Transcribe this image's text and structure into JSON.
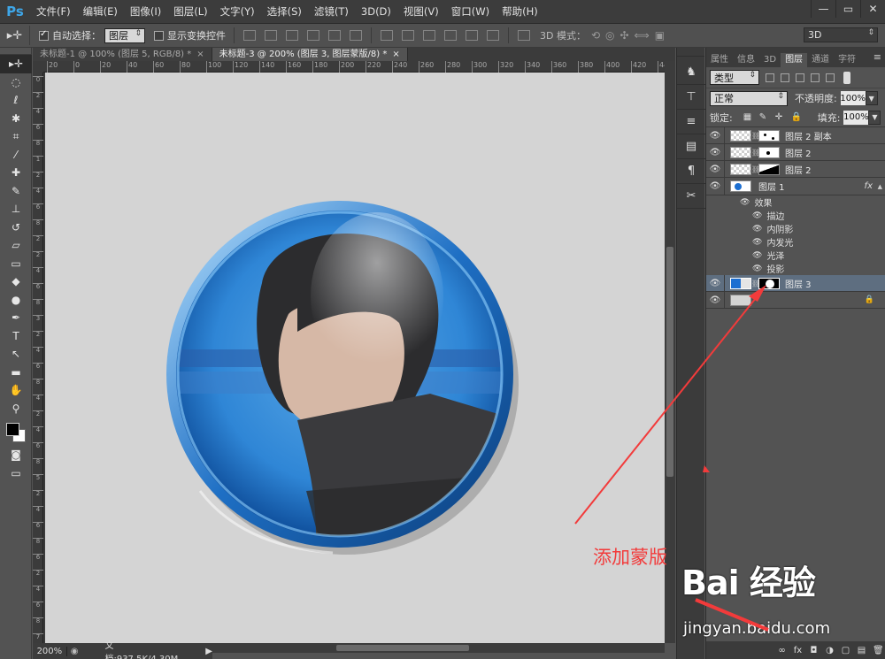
{
  "app": {
    "logo": "Ps"
  },
  "menu": [
    "文件(F)",
    "编辑(E)",
    "图像(I)",
    "图层(L)",
    "文字(Y)",
    "选择(S)",
    "滤镜(T)",
    "3D(D)",
    "视图(V)",
    "窗口(W)",
    "帮助(H)"
  ],
  "window_controls": {
    "minimize": "—",
    "maximize": "▭",
    "close": "✕"
  },
  "options": {
    "auto_select_label": "自动选择：",
    "auto_select_value": "图层",
    "show_transform_label": "显示变换控件",
    "mode_3d_label": "3D 模式：",
    "workspace": "3D"
  },
  "doc_tabs": [
    {
      "label": "未标题-1 @ 100% (图层 5, RGB/8) *",
      "close": "×"
    },
    {
      "label": "未标题-3 @ 200% (图层 3, 图层蒙版/8) *",
      "close": "×"
    }
  ],
  "ruler_top_ticks": [
    "20",
    "0",
    "20",
    "40",
    "60",
    "80",
    "100",
    "120",
    "140",
    "160",
    "180",
    "200",
    "220",
    "240",
    "260",
    "280",
    "300",
    "320",
    "340",
    "360",
    "380",
    "400",
    "420",
    "440"
  ],
  "ruler_left_ticks": [
    "0",
    "2",
    "4",
    "6",
    "8",
    "1",
    "2",
    "4",
    "6",
    "8",
    "2",
    "2",
    "4",
    "6",
    "8",
    "3",
    "2",
    "4",
    "6",
    "8",
    "4",
    "2",
    "4",
    "6",
    "8",
    "5",
    "2",
    "4",
    "6",
    "8",
    "6",
    "2",
    "4",
    "6",
    "8",
    "7"
  ],
  "status": {
    "zoom": "200%",
    "doc": "文档:937.5K/4.30M"
  },
  "tools": [
    {
      "name": "move-tool",
      "glyph": "▸✛",
      "active": true
    },
    {
      "name": "marquee-tool",
      "glyph": "◌"
    },
    {
      "name": "lasso-tool",
      "glyph": "ℓ"
    },
    {
      "name": "magic-wand-tool",
      "glyph": "✱"
    },
    {
      "name": "crop-tool",
      "glyph": "⌗"
    },
    {
      "name": "eyedropper-tool",
      "glyph": "⁄"
    },
    {
      "name": "healing-brush-tool",
      "glyph": "✚"
    },
    {
      "name": "brush-tool",
      "glyph": "✎"
    },
    {
      "name": "clone-stamp-tool",
      "glyph": "⊥"
    },
    {
      "name": "history-brush-tool",
      "glyph": "↺"
    },
    {
      "name": "eraser-tool",
      "glyph": "▱"
    },
    {
      "name": "gradient-tool",
      "glyph": "▭"
    },
    {
      "name": "blur-tool",
      "glyph": "◆"
    },
    {
      "name": "dodge-tool",
      "glyph": "●"
    },
    {
      "name": "pen-tool",
      "glyph": "✒"
    },
    {
      "name": "type-tool",
      "glyph": "T"
    },
    {
      "name": "path-selection-tool",
      "glyph": "↖"
    },
    {
      "name": "rectangle-tool",
      "glyph": "▬"
    },
    {
      "name": "hand-tool",
      "glyph": "✋"
    },
    {
      "name": "zoom-tool",
      "glyph": "⚲"
    }
  ],
  "annotation": {
    "text": "添加蒙版",
    "color": "#f23b3b"
  },
  "mini_panel": [
    "♞",
    "⊤",
    "≡",
    "▤",
    "¶",
    "✂"
  ],
  "panel": {
    "tabs": [
      "属性",
      "信息",
      "3D",
      "图层",
      "通道",
      "字符"
    ],
    "active_tab": "图层",
    "menu_icon": "≡",
    "filter_kind": "类型",
    "blend_mode": "正常",
    "opacity_label": "不透明度:",
    "opacity_value": "100%",
    "lock_label": "锁定:",
    "fill_label": "填充:",
    "fill_value": "100%"
  },
  "layers": [
    {
      "name": "图层 2 副本",
      "type": "masked",
      "mask": "dots"
    },
    {
      "name": "图层 2",
      "type": "masked",
      "mask": "dot"
    },
    {
      "name": "图层 2",
      "type": "masked",
      "mask": "diag"
    },
    {
      "name": "图层 1",
      "type": "fx",
      "fx": "fx"
    },
    {
      "name": "图层 3",
      "type": "selected",
      "mask": "circle"
    },
    {
      "name": "",
      "type": "background"
    }
  ],
  "effects": {
    "title": "效果",
    "items": [
      "描边",
      "内阴影",
      "内发光",
      "光泽",
      "投影"
    ]
  },
  "panel_bottom_icons": [
    "∞",
    "fx",
    "◘",
    "◑",
    "▢",
    "▤",
    "🗑"
  ],
  "watermark": {
    "logo": "Bai 经验",
    "url": "jingyan.baidu.com"
  },
  "colors": {
    "accent": "#3ea6e8",
    "annotation": "#f23b3b",
    "selection": "#5e6e80"
  }
}
